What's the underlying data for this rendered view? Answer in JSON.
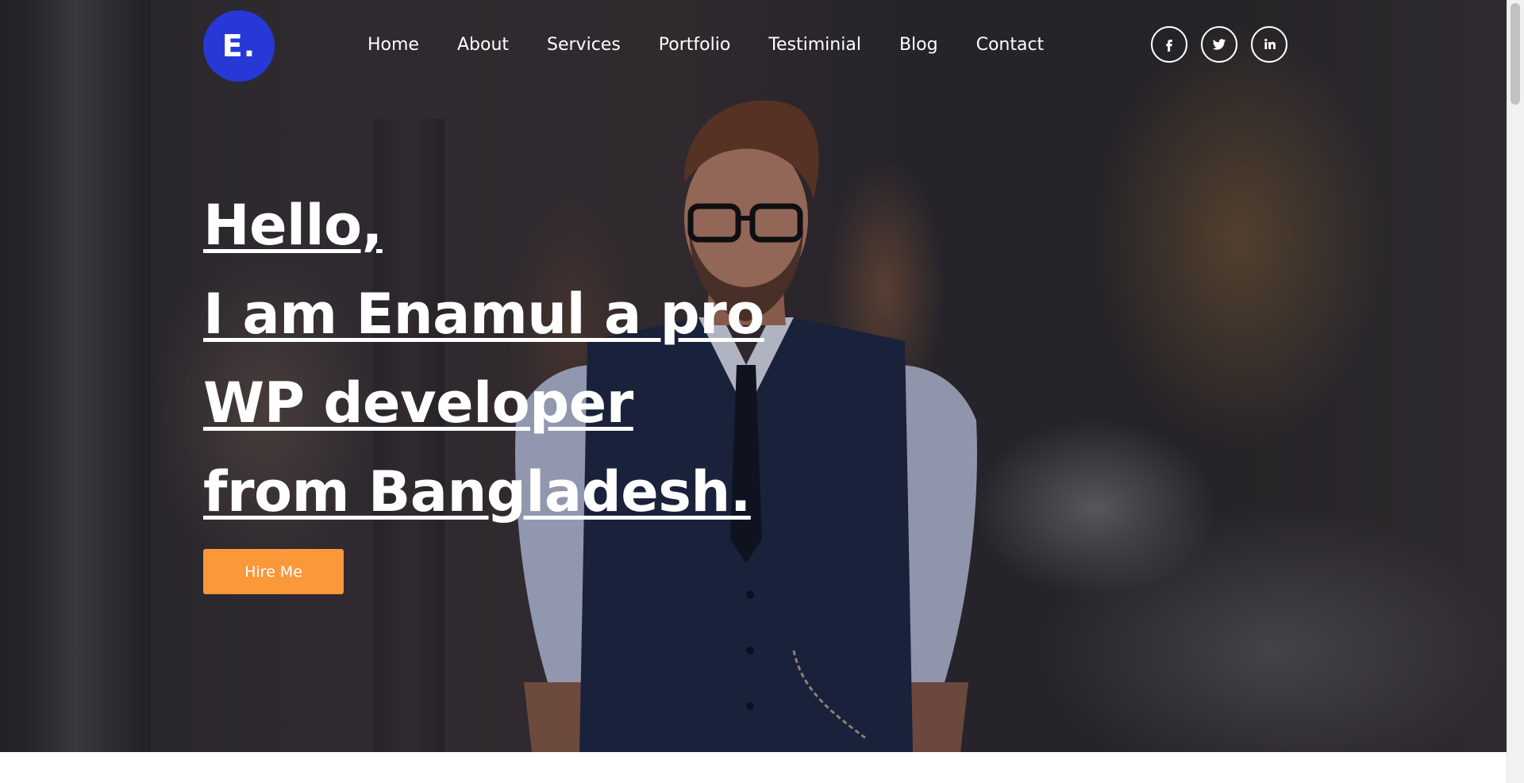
{
  "logo": {
    "text": "E.",
    "bg": "#2639d6"
  },
  "nav": {
    "items": [
      {
        "label": "Home"
      },
      {
        "label": "About"
      },
      {
        "label": "Services"
      },
      {
        "label": "Portfolio"
      },
      {
        "label": "Testiminial"
      },
      {
        "label": "Blog"
      },
      {
        "label": "Contact"
      }
    ]
  },
  "social": [
    {
      "icon": "facebook-icon"
    },
    {
      "icon": "twitter-icon"
    },
    {
      "icon": "linkedin-icon"
    }
  ],
  "hero": {
    "lines": [
      "Hello,",
      "I am Enamul a pro",
      "WP developer",
      "from Bangladesh."
    ],
    "cta_label": "Hire Me",
    "cta_color": "#fb9839"
  }
}
